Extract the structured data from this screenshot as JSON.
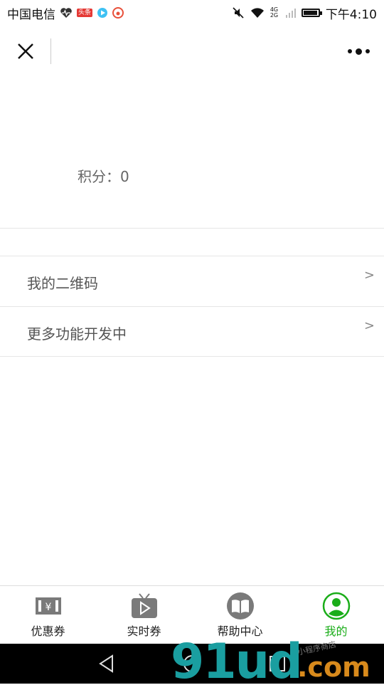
{
  "status_bar": {
    "carrier": "中国电信",
    "badge": "头条",
    "network": "4G 2G",
    "time": "下午4:10",
    "battery_level": 0.85
  },
  "topbar": {
    "close_icon": "close-icon",
    "more_icon": "more-icon"
  },
  "points": {
    "label": "积分：",
    "value": "0"
  },
  "menu": [
    {
      "label": "我的二维码",
      "arrow": ">"
    },
    {
      "label": "更多功能开发中",
      "arrow": ">"
    }
  ],
  "tabs": [
    {
      "label": "优惠券",
      "icon": "coupon-icon"
    },
    {
      "label": "实时券",
      "icon": "tv-play-icon"
    },
    {
      "label": "帮助中心",
      "icon": "book-icon"
    },
    {
      "label": "我的",
      "icon": "user-icon",
      "active": true
    }
  ],
  "colors": {
    "active_tab": "#1aad19",
    "inactive_icon": "#7a7a7a"
  },
  "watermark": {
    "main": "91ud",
    "suffix": ".com",
    "small": "小程序商店"
  }
}
